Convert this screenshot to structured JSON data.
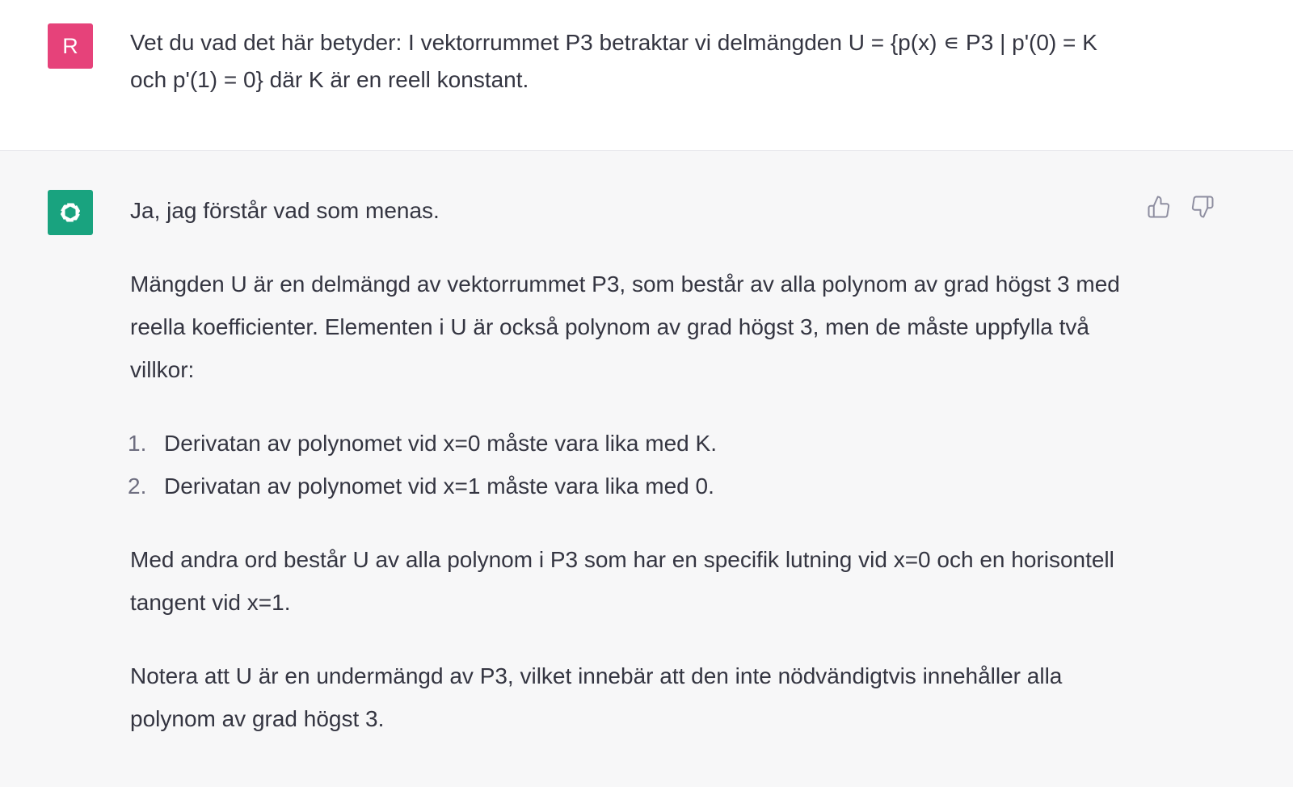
{
  "user": {
    "avatar_letter": "R",
    "avatar_color": "#e6427a",
    "message": "Vet du vad det här betyder: I vektorrummet P3 betraktar vi delmängden U = {p(x) ∊ P3 | p'(0) = K och p'(1) = 0} där K är en reell konstant."
  },
  "assistant": {
    "avatar_icon": "openai-logo-icon",
    "avatar_color": "#19a37f",
    "paragraphs": [
      "Ja, jag förstår vad som menas.",
      "Mängden U är en delmängd av vektorrummet P3, som består av alla polynom av grad högst 3 med reella koefficienter. Elementen i U är också polynom av grad högst 3, men de måste uppfylla två villkor:"
    ],
    "list": [
      {
        "num": "1.",
        "text": "Derivatan av polynomet vid x=0 måste vara lika med K."
      },
      {
        "num": "2.",
        "text": "Derivatan av polynomet vid x=1 måste vara lika med 0."
      }
    ],
    "paragraphs_after": [
      "Med andra ord består U av alla polynom i P3 som har en specifik lutning vid x=0 och en horisontell tangent vid x=1.",
      "Notera att U är en undermängd av P3, vilket innebär att den inte nödvändigtvis innehåller alla polynom av grad högst 3."
    ],
    "feedback": {
      "like_icon": "thumbs-up-icon",
      "dislike_icon": "thumbs-down-icon"
    }
  }
}
